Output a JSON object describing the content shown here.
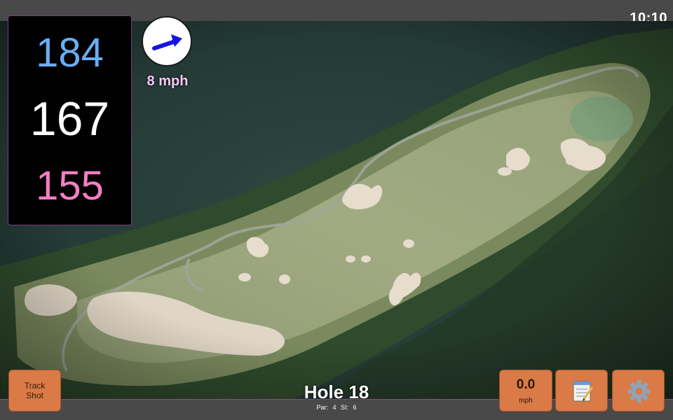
{
  "status": {
    "time": "10:10"
  },
  "distances": {
    "back": "184",
    "middle": "167",
    "front": "155"
  },
  "wind": {
    "speed_label": "8 mph"
  },
  "track_shot": {
    "line1": "Track",
    "line2": "Shot"
  },
  "hole": {
    "title": "Hole 18",
    "par": "Par: 4",
    "stroke_index": "SI: 6"
  },
  "speed": {
    "value": "0.0",
    "unit": "mph"
  },
  "icons": {
    "wind": "wind-direction-arrow-icon",
    "notes": "notepad-icon",
    "settings": "gear-icon"
  },
  "colors": {
    "back_distance": "#6aadf3",
    "middle_distance": "#ffffff",
    "front_distance": "#f27fc4",
    "button": "#d97a47",
    "wind_text": "#f6c8f5"
  }
}
